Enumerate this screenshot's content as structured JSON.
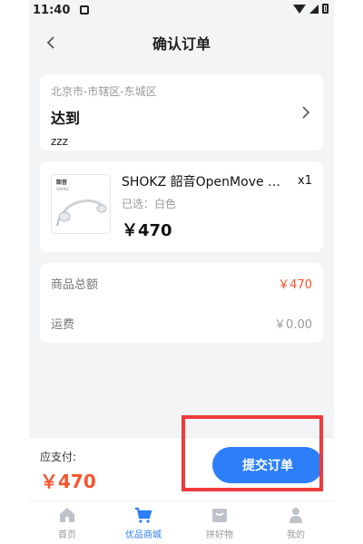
{
  "status_bar": {
    "time": "11:40"
  },
  "header": {
    "title": "确认订单"
  },
  "address": {
    "region": "北京市-市辖区-东城区",
    "name": "达到",
    "detail": "zzz"
  },
  "product": {
    "thumb_brand": "韶音",
    "thumb_sub": "SHOKZ",
    "name": "SHOKZ 韶音OpenMove 骨传导耳机",
    "quantity": "x1",
    "spec": "已选：白色",
    "price": "￥470"
  },
  "summary": {
    "goods_total_label": "商品总额",
    "goods_total_value": "￥470",
    "shipping_label": "运费",
    "shipping_value": "￥0.00"
  },
  "payment": {
    "label": "应支付:",
    "amount": "￥470",
    "submit_label": "提交订单"
  },
  "tabs": [
    {
      "label": "首页",
      "icon": "home-icon",
      "active": false
    },
    {
      "label": "优品商城",
      "icon": "cart-icon",
      "active": true
    },
    {
      "label": "拼好物",
      "icon": "bag-icon",
      "active": false
    },
    {
      "label": "我的",
      "icon": "user-icon",
      "active": false
    }
  ],
  "colors": {
    "accent": "#2d7ff9",
    "price_red": "#f5542d",
    "highlight": "#ef3b3b"
  }
}
